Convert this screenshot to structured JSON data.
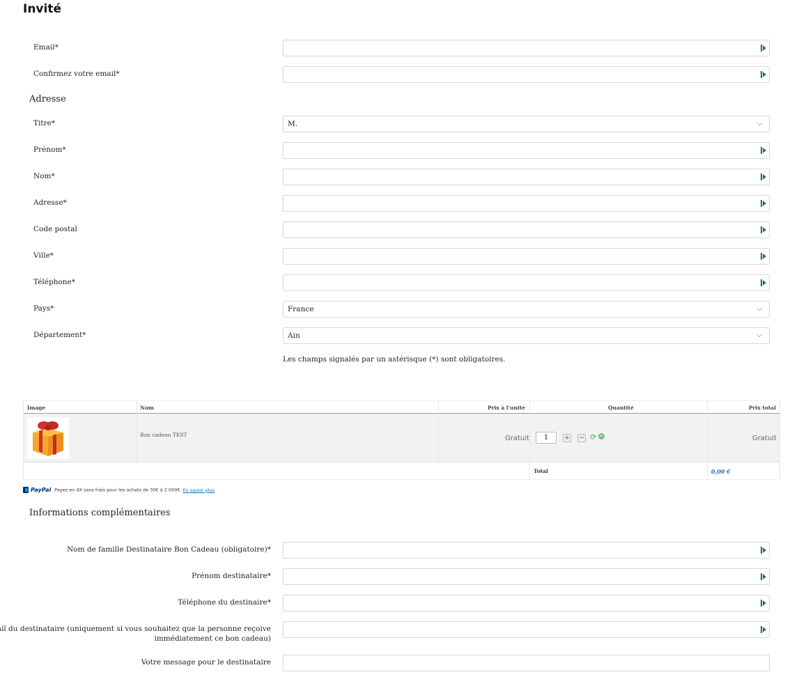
{
  "page": {
    "title": "Invité"
  },
  "account": {
    "email_label": "Email*",
    "confirm_email_label": "Confirmez votre email*"
  },
  "address": {
    "section_title": "Adresse",
    "title_label": "Titre*",
    "title_value": "M.",
    "firstname_label": "Prénom*",
    "lastname_label": "Nom*",
    "address_label": "Adresse*",
    "postcode_label": "Code postal",
    "city_label": "Ville*",
    "phone_label": "Téléphone*",
    "country_label": "Pays*",
    "country_value": "France",
    "department_label": "Département*",
    "department_value": "Ain",
    "required_note": "Les champs signalés par un astérisque (*) sont obligatoires."
  },
  "cart": {
    "headers": {
      "image": "Image",
      "name": "Nom",
      "unit_price": "Prix à l'unité",
      "quantity": "Quantité",
      "total_price": "Prix total"
    },
    "items": [
      {
        "name": "Bon cadeau TEST",
        "unit_price": "Gratuit",
        "quantity": "1",
        "total": "Gratuit"
      }
    ],
    "total_label": "Total",
    "total_value": "0,00 €"
  },
  "paypal": {
    "brand": "PayPal",
    "text": "Payez en 4X sans frais pour les achats de 30€ à 2 000€.",
    "link": "En savoir plus"
  },
  "extra": {
    "section_title": "Informations complémentaires",
    "recipient_lastname_label": "Nom de famille Destinataire Bon Cadeau (obligatoire)*",
    "recipient_firstname_label": "Prénom destinataire*",
    "recipient_phone_label": "Téléphone du destinaire*",
    "recipient_mail_label_line1": "mail du destinataire (uniquement si vous souhaitez que la personne reçoive",
    "recipient_mail_label_line2": "immédiatement ce bon cadeau)",
    "message_label": "Votre message pour le destinataire"
  },
  "icons": {
    "field_autofill": "autofill-key-icon",
    "select_arrow": "chevron-down-icon",
    "refresh": "refresh-icon",
    "remove": "remove-icon"
  },
  "colors": {
    "link": "#2e6da4",
    "autofill_icon": "#2f6a73",
    "paypal_blue": "#003087"
  }
}
